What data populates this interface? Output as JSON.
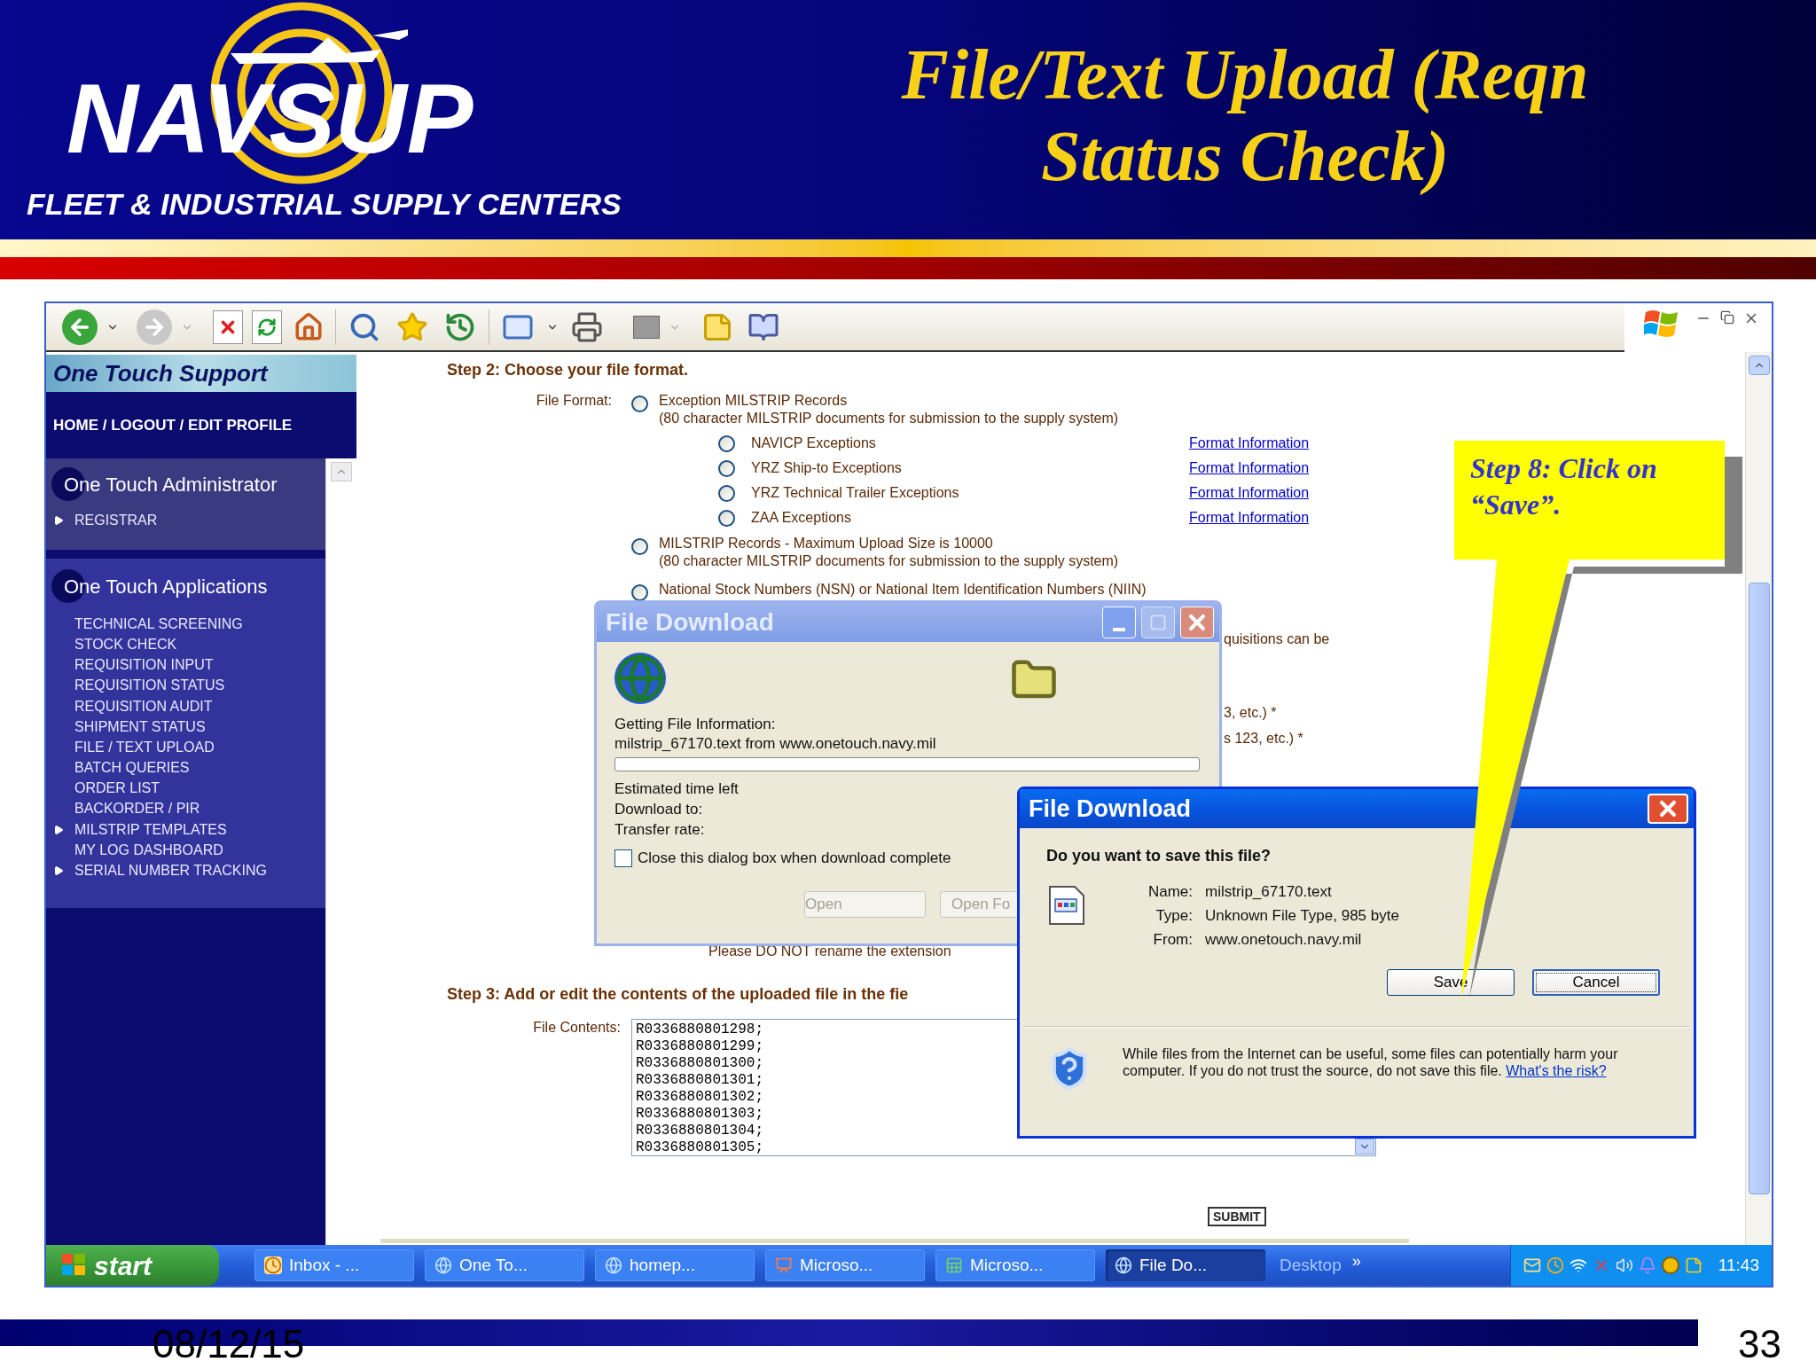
{
  "slide": {
    "logo_text": "NAVSUP",
    "logo_caption": "FLEET & INDUSTRIAL SUPPLY CENTERS",
    "title_lines": [
      "File/Text Upload (Reqn",
      "Status Check)"
    ],
    "date": "08/12/15",
    "page_number": "33"
  },
  "sidebar": {
    "brand": "One Touch Support",
    "top_links": "HOME / LOGOUT / EDIT PROFILE",
    "sections": [
      {
        "title": "One Touch Administrator",
        "items": [
          {
            "label": "REGISTRAR",
            "expandable": true
          }
        ]
      },
      {
        "title": "One Touch Applications",
        "items": [
          {
            "label": "TECHNICAL SCREENING",
            "expandable": false
          },
          {
            "label": "STOCK CHECK",
            "expandable": false
          },
          {
            "label": "REQUISITION INPUT",
            "expandable": false
          },
          {
            "label": "REQUISITION STATUS",
            "expandable": false
          },
          {
            "label": "REQUISITION AUDIT",
            "expandable": false
          },
          {
            "label": "SHIPMENT STATUS",
            "expandable": false
          },
          {
            "label": "FILE / TEXT UPLOAD",
            "expandable": false
          },
          {
            "label": "BATCH QUERIES",
            "expandable": false
          },
          {
            "label": "ORDER LIST",
            "expandable": false
          },
          {
            "label": "BACKORDER / PIR",
            "expandable": false
          },
          {
            "label": "MILSTRIP TEMPLATES",
            "expandable": true
          },
          {
            "label": "MY LOG DASHBOARD",
            "expandable": false
          },
          {
            "label": "SERIAL NUMBER TRACKING",
            "expandable": true
          }
        ]
      }
    ]
  },
  "page": {
    "step2_heading": "Step 2: Choose your file format.",
    "file_format_label": "File Format:",
    "options": [
      {
        "label": "Exception MILSTRIP Records",
        "note": "(80 character MILSTRIP documents for submission to the supply system)",
        "selected": false,
        "children": [
          {
            "label": "NAVICP Exceptions",
            "link": "Format Information",
            "selected": false
          },
          {
            "label": "YRZ Ship-to Exceptions",
            "link": "Format Information",
            "selected": false
          },
          {
            "label": "YRZ Technical Trailer Exceptions",
            "link": "Format Information",
            "selected": false
          },
          {
            "label": "ZAA Exceptions",
            "link": "Format Information",
            "selected": false
          }
        ]
      },
      {
        "label": "MILSTRIP Records - Maximum Upload Size is 10000",
        "note": "(80 character MILSTRIP documents for submission to the supply system)",
        "selected": false
      },
      {
        "label": "National Stock Numbers (NSN) or National Item Identification Numbers (NIIN)",
        "selected": false
      }
    ],
    "fragments": [
      "quisitions can be",
      "3, etc.) *",
      "s 123, etc.) *"
    ],
    "rename_note": "Please DO NOT rename the extension",
    "step3_heading": "Step 3: Add or edit the contents of the uploaded file in the fie",
    "file_contents_label": "File Contents:",
    "file_contents": [
      "R0336880801298;",
      "R0336880801299;",
      "R0336880801300;",
      "R0336880801301;",
      "R0336880801302;",
      "R0336880801303;",
      "R0336880801304;",
      "R0336880801305;"
    ],
    "submit": "SUBMIT"
  },
  "progress_dialog": {
    "title": "File Download",
    "status": "Getting File Information:",
    "file_line": "milstrip_67170.text from www.onetouch.navy.mil",
    "level": 0,
    "details": [
      "Estimated time left",
      "Download to:",
      "Transfer rate:"
    ],
    "close_when_done": {
      "label": "Close this dialog box when download complete",
      "checked": false
    },
    "buttons": [
      {
        "label": "Open",
        "disabled": true
      },
      {
        "label": "Open Fo",
        "disabled": true
      }
    ]
  },
  "save_dialog": {
    "title": "File Download",
    "question": "Do you want to save this file?",
    "fields": [
      {
        "label": "Name:",
        "value": "milstrip_67170.text"
      },
      {
        "label": "Type:",
        "value": "Unknown File Type, 985 byte"
      },
      {
        "label": "From:",
        "value": "www.onetouch.navy.mil"
      }
    ],
    "buttons": [
      {
        "label": "Save",
        "focused": false
      },
      {
        "label": "Cancel",
        "focused": true
      }
    ],
    "warning": "While files from the Internet can be useful, some files can potentially harm your computer. If you do not trust the source, do not save this file.",
    "risk_link": "What's the risk?"
  },
  "callout": {
    "text": "Step 8: Click on “Save”."
  },
  "taskbar": {
    "start": "start",
    "items": [
      {
        "label": "Inbox - ...",
        "kind": "clock",
        "selected": false
      },
      {
        "label": "One To...",
        "kind": "browser",
        "selected": false
      },
      {
        "label": "homep...",
        "kind": "browser",
        "selected": false
      },
      {
        "label": "Microso...",
        "kind": "slides",
        "selected": false
      },
      {
        "label": "Microso...",
        "kind": "sheet",
        "selected": false
      },
      {
        "label": "File Do...",
        "kind": "browser",
        "selected": true
      }
    ],
    "desktop": "Desktop",
    "more": "»",
    "time": "11:43"
  }
}
